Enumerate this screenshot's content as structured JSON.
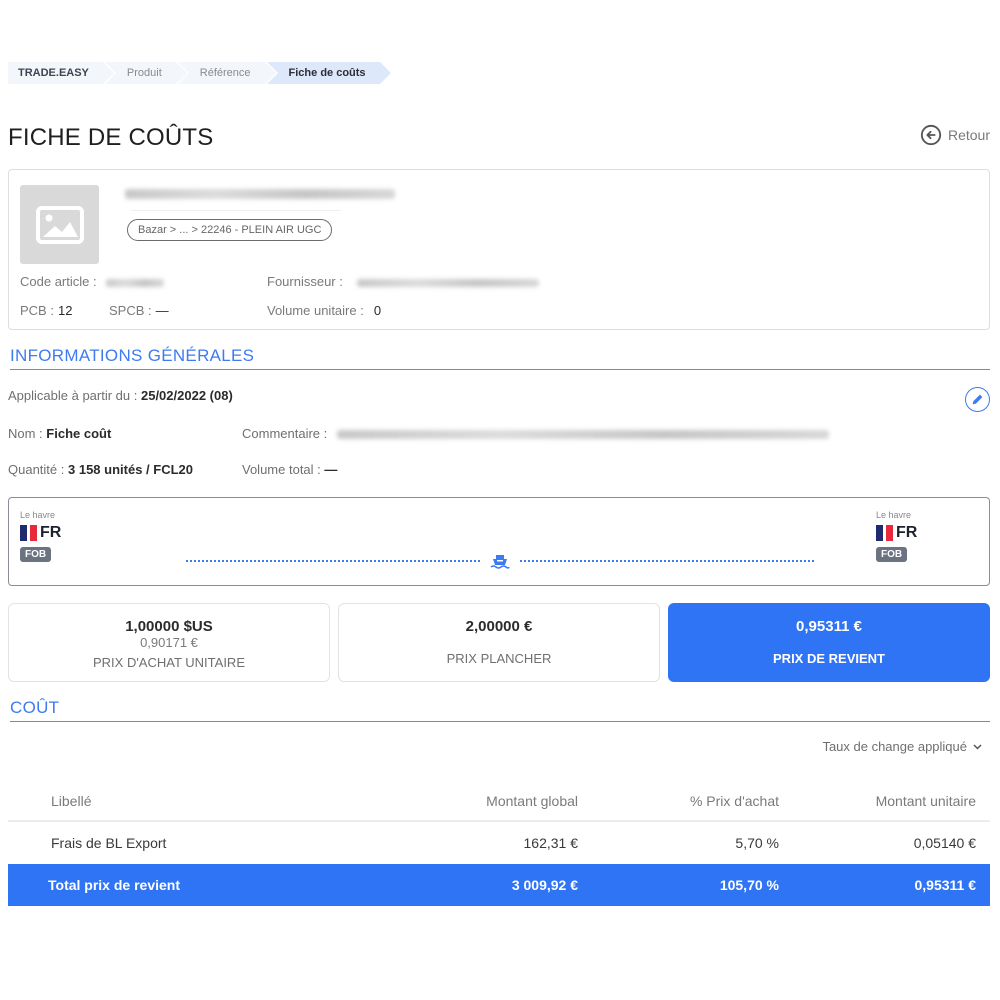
{
  "breadcrumb": [
    {
      "label": "TRADE.EASY"
    },
    {
      "label": "Produit"
    },
    {
      "label": "Référence"
    },
    {
      "label": "Fiche de coûts"
    }
  ],
  "header": {
    "title": "FICHE DE COÛTS",
    "back_label": "Retour"
  },
  "product": {
    "image_icon": "image-placeholder-icon",
    "category_path": "Bazar > ... > 22246 - PLEIN AIR UGC",
    "code_article_label": "Code article :",
    "fournisseur_label": "Fournisseur :",
    "pcb_label": "PCB :",
    "pcb_value": "12",
    "spcb_label": "SPCB :",
    "spcb_value": "—",
    "volume_unitaire_label": "Volume unitaire :",
    "volume_unitaire_value": "0"
  },
  "general_info": {
    "section_title": "INFORMATIONS GÉNÉRALES",
    "applicable_label": "Applicable à partir du :",
    "applicable_value": "25/02/2022 (08)",
    "nom_label": "Nom :",
    "nom_value": "Fiche coût",
    "commentaire_label": "Commentaire :",
    "quantite_label": "Quantité :",
    "quantite_value": "3 158 unités / FCL20",
    "volume_total_label": "Volume total :",
    "volume_total_value": "—",
    "edit_icon": "pencil-icon"
  },
  "route": {
    "origin": {
      "port": "Le havre",
      "country": "FR",
      "incoterm": "FOB"
    },
    "destination": {
      "port": "Le havre",
      "country": "FR",
      "incoterm": "FOB"
    },
    "transport_icon": "ship-icon",
    "accent_color": "#3d7bf0"
  },
  "prices": [
    {
      "main": "1,00000 $US",
      "sub": "0,90171 €",
      "label": "PRIX D'ACHAT UNITAIRE"
    },
    {
      "main": "2,00000 €",
      "label": "PRIX PLANCHER"
    },
    {
      "main": "0,95311 €",
      "label": "PRIX DE REVIENT",
      "highlighted": true
    }
  ],
  "cost": {
    "section_title": "COÛT",
    "fx_toggle_label": "Taux de change appliqué",
    "columns": [
      "Libellé",
      "Montant global",
      "% Prix d'achat",
      "Montant unitaire"
    ],
    "rows": [
      [
        "Frais de BL Export",
        "162,31 €",
        "5,70 %",
        "0,05140 €"
      ]
    ],
    "total": [
      "Total prix de revient",
      "3 009,92 €",
      "105,70 %",
      "0,95311 €"
    ]
  },
  "colors": {
    "primary": "#2f74f5",
    "section_accent": "#3d7bf0"
  }
}
